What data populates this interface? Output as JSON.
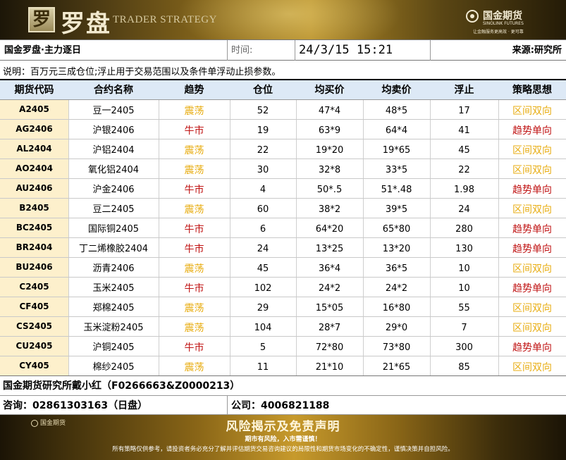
{
  "header": {
    "logo_char": "罗",
    "title": "罗盘",
    "subtitle": "TRADER STRATEGY",
    "company_cn": "国金期货",
    "company_en": "SINOLINK FUTURES",
    "company_slogan": "让金融服务更高效 · 更可靠"
  },
  "info": {
    "title": "国金罗盘·主力逐日",
    "time_label": "时间:",
    "time_value": "24/3/15  15:21",
    "source": "来源:研究所"
  },
  "note": "说明：百万元三成仓位;浮止用于交易范围以及条件单浮动止损参数。",
  "table": {
    "headers": [
      "期货代码",
      "合约名称",
      "趋势",
      "仓位",
      "均买价",
      "均卖价",
      "浮止",
      "策略思想"
    ],
    "rows": [
      {
        "code": "A2405",
        "name": "豆一2405",
        "trend": "震荡",
        "pos": "52",
        "buy": "47*4",
        "sell": "48*5",
        "float": "17",
        "strategy": "区间双向",
        "kind": "osc"
      },
      {
        "code": "AG2406",
        "name": "沪银2406",
        "trend": "牛市",
        "pos": "19",
        "buy": "63*9",
        "sell": "64*4",
        "float": "41",
        "strategy": "趋势单向",
        "kind": "bull"
      },
      {
        "code": "AL2404",
        "name": "沪铝2404",
        "trend": "震荡",
        "pos": "22",
        "buy": "19*20",
        "sell": "19*65",
        "float": "45",
        "strategy": "区间双向",
        "kind": "osc"
      },
      {
        "code": "AO2404",
        "name": "氧化铝2404",
        "trend": "震荡",
        "pos": "30",
        "buy": "32*8",
        "sell": "33*5",
        "float": "22",
        "strategy": "区间双向",
        "kind": "osc"
      },
      {
        "code": "AU2406",
        "name": "沪金2406",
        "trend": "牛市",
        "pos": "4",
        "buy": "50*.5",
        "sell": "51*.48",
        "float": "1.98",
        "strategy": "趋势单向",
        "kind": "bull"
      },
      {
        "code": "B2405",
        "name": "豆二2405",
        "trend": "震荡",
        "pos": "60",
        "buy": "38*2",
        "sell": "39*5",
        "float": "24",
        "strategy": "区间双向",
        "kind": "osc"
      },
      {
        "code": "BC2405",
        "name": "国际铜2405",
        "trend": "牛市",
        "pos": "6",
        "buy": "64*20",
        "sell": "65*80",
        "float": "280",
        "strategy": "趋势单向",
        "kind": "bull"
      },
      {
        "code": "BR2404",
        "name": "丁二烯橡胶2404",
        "trend": "牛市",
        "pos": "24",
        "buy": "13*25",
        "sell": "13*20",
        "float": "130",
        "strategy": "趋势单向",
        "kind": "bull"
      },
      {
        "code": "BU2406",
        "name": "沥青2406",
        "trend": "震荡",
        "pos": "45",
        "buy": "36*4",
        "sell": "36*5",
        "float": "10",
        "strategy": "区间双向",
        "kind": "osc"
      },
      {
        "code": "C2405",
        "name": "玉米2405",
        "trend": "牛市",
        "pos": "102",
        "buy": "24*2",
        "sell": "24*2",
        "float": "10",
        "strategy": "趋势单向",
        "kind": "bull"
      },
      {
        "code": "CF405",
        "name": "郑棉2405",
        "trend": "震荡",
        "pos": "29",
        "buy": "15*05",
        "sell": "16*80",
        "float": "55",
        "strategy": "区间双向",
        "kind": "osc"
      },
      {
        "code": "CS2405",
        "name": "玉米淀粉2405",
        "trend": "震荡",
        "pos": "104",
        "buy": "28*7",
        "sell": "29*0",
        "float": "7",
        "strategy": "区间双向",
        "kind": "osc"
      },
      {
        "code": "CU2405",
        "name": "沪铜2405",
        "trend": "牛市",
        "pos": "5",
        "buy": "72*80",
        "sell": "73*80",
        "float": "300",
        "strategy": "趋势单向",
        "kind": "bull"
      },
      {
        "code": "CY405",
        "name": "棉纱2405",
        "trend": "震荡",
        "pos": "11",
        "buy": "21*10",
        "sell": "21*65",
        "float": "85",
        "strategy": "区间双向",
        "kind": "osc"
      }
    ]
  },
  "footer": {
    "analyst": "国金期货研究所戴小红（F0266663&Z0000213）",
    "consult": "咨询：02861303163（日盘）",
    "company_phone": "公司：4006821188"
  },
  "disclaimer": {
    "logo_text": "国金期货",
    "headline": "风险揭示及免责声明",
    "motto": "期市有风险，入市需谨慎！",
    "detail": "所有策略仅供参考，请投资者务必充分了解并评估期货交易咨询建议的局限性和期货市场变化的不确定性，谨慎决策并自担风险。"
  },
  "colors": {
    "oscillation": "#e8ad12",
    "bull": "#c01414",
    "code_bg": "#fdf0cc",
    "header_bg": "#dde9f6"
  }
}
